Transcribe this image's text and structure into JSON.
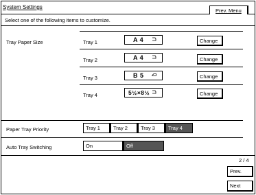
{
  "window": {
    "title": "System Settings",
    "prev_menu_label": "Prev. Menu"
  },
  "instruction": "Select one of the following items to customize.",
  "tray_paper_size": {
    "label": "Tray Paper Size",
    "trays": [
      {
        "name": "Tray 1",
        "size": "A 4",
        "orientation_icon": "portrait-orientation-icon",
        "button": "Change"
      },
      {
        "name": "Tray 2",
        "size": "A 4",
        "orientation_icon": "portrait-orientation-icon",
        "button": "Change"
      },
      {
        "name": "Tray 3",
        "size": "B 5",
        "orientation_icon": "landscape-orientation-icon",
        "button": "Change"
      },
      {
        "name": "Tray 4",
        "size": "5½×8½",
        "orientation_icon": "portrait-orientation-icon",
        "button": "Change"
      }
    ]
  },
  "paper_tray_priority": {
    "label": "Paper Tray Priority",
    "options": [
      "Tray 1",
      "Tray 2",
      "Tray 3",
      "Tray 4"
    ],
    "selected": "Tray 4"
  },
  "auto_tray_switching": {
    "label": "Auto Tray Switching",
    "options": [
      "On",
      "Off"
    ],
    "selected": "Off"
  },
  "pagination": {
    "page": "2 / 4",
    "prev_label": "Prev.",
    "next_label": "Next"
  },
  "colors": {
    "selected_bg": "#555555",
    "selected_fg": "#ffffff",
    "border": "#000000",
    "background": "#ffffff"
  }
}
